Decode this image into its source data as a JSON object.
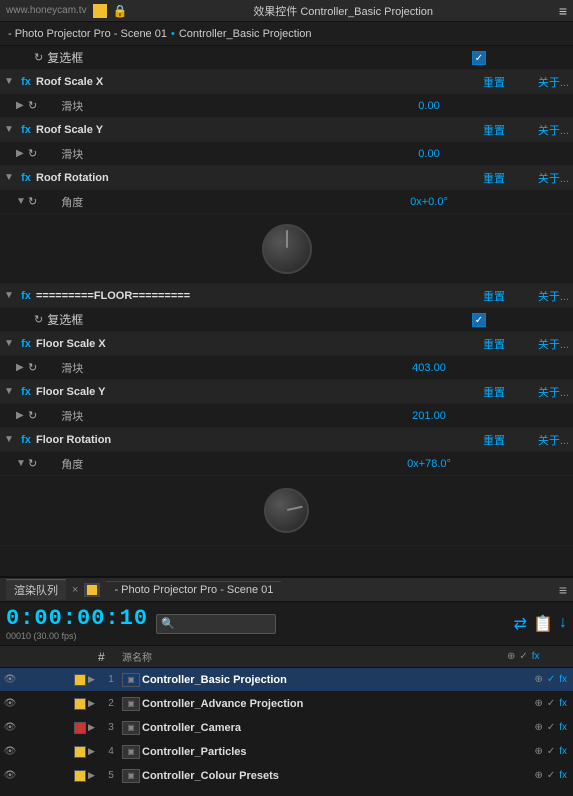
{
  "topbar": {
    "logo": "www.honeycam.tv",
    "title": "效果控件 Controller_Basic Projection",
    "menu": "≡"
  },
  "breadcrumb": {
    "prefix": "- Photo Projector Pro - Scene 01",
    "separator": "•",
    "layer": "Controller_Basic Projection"
  },
  "effects": {
    "sections": [
      {
        "id": "roof-section",
        "checkbox_row": true,
        "checkbox_checked": true
      },
      {
        "id": "roof-scale-x",
        "fx": true,
        "label": "Roof Scale X",
        "reset": "重置",
        "about": "关于..."
      },
      {
        "id": "roof-scale-x-sub",
        "sub": true,
        "icon": "↻",
        "sublabel": "滑块",
        "value": "0.00"
      },
      {
        "id": "roof-scale-y",
        "fx": true,
        "label": "Roof Scale Y",
        "reset": "重置",
        "about": "关于..."
      },
      {
        "id": "roof-scale-y-sub",
        "sub": true,
        "icon": "↻",
        "sublabel": "滑块",
        "value": "0.00"
      },
      {
        "id": "roof-rotation",
        "fx": true,
        "label": "Roof Rotation",
        "reset": "重置",
        "about": "关于..."
      },
      {
        "id": "roof-rotation-sub",
        "sub": true,
        "icon": "↻",
        "sublabel": "角度",
        "value": "0x+0.0°"
      }
    ],
    "knob1_rotation": 0,
    "floor_separator": "=========FLOOR=========",
    "floor_reset": "重置",
    "floor_about": "关于...",
    "floor_checkbox_checked": true,
    "floor_sections": [
      {
        "id": "floor-scale-x",
        "fx": true,
        "label": "Floor Scale X",
        "reset": "重置",
        "about": "关于..."
      },
      {
        "id": "floor-scale-x-sub",
        "sub": true,
        "icon": "↻",
        "sublabel": "滑块",
        "value": "403.00"
      },
      {
        "id": "floor-scale-y",
        "fx": true,
        "label": "Floor Scale Y",
        "reset": "重置",
        "about": "关于..."
      },
      {
        "id": "floor-scale-y-sub",
        "sub": true,
        "icon": "↻",
        "sublabel": "滑块",
        "value": "201.00"
      },
      {
        "id": "floor-rotation",
        "fx": true,
        "label": "Floor Rotation",
        "reset": "重置",
        "about": "关于..."
      },
      {
        "id": "floor-rotation-sub",
        "sub": true,
        "icon": "↻",
        "sublabel": "角度",
        "value": "0x+78.0°"
      }
    ]
  },
  "render_queue": {
    "tab_label": "渲染队列",
    "tab_close": "×",
    "scene_tab": "- Photo Projector Pro - Scene 01",
    "scene_menu": "≡",
    "timecode": "0:00:00:10",
    "frames": "00010 (30.00 fps)",
    "search_placeholder": "🔍",
    "table_header": {
      "source_name": "源名称"
    },
    "layers": [
      {
        "num": "1",
        "color": "#f0c030",
        "name": "Controller_Basic Projection",
        "active": true
      },
      {
        "num": "2",
        "color": "#f0c030",
        "name": "Controller_Advance Projection",
        "active": false
      },
      {
        "num": "3",
        "color": "#cc3333",
        "name": "Controller_Camera",
        "active": false
      },
      {
        "num": "4",
        "color": "#f0c030",
        "name": "Controller_Particles",
        "active": false
      },
      {
        "num": "5",
        "color": "#f0c030",
        "name": "Controller_Colour Presets",
        "active": false
      }
    ]
  }
}
